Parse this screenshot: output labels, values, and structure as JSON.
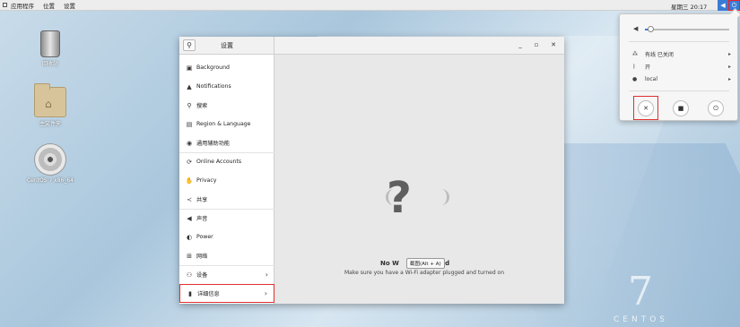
{
  "topbar": {
    "apps": "应用程序",
    "places": "位置",
    "settings": "设置",
    "clock": "星期三 20:17"
  },
  "desktop": {
    "trash_label": "回收站",
    "home_label": "主文件夹",
    "disc_label": "CentOS 7 x86_64"
  },
  "window": {
    "title": "设置",
    "sidebar": [
      {
        "label": "Background",
        "icon": "image-icon"
      },
      {
        "label": "Notifications",
        "icon": "bell-icon"
      },
      {
        "label": "搜索",
        "icon": "search-icon"
      },
      {
        "label": "Region & Language",
        "icon": "camera-icon"
      },
      {
        "label": "通用辅助功能",
        "icon": "accessibility-icon"
      },
      {
        "label": "Online Accounts",
        "icon": "online-accounts-icon"
      },
      {
        "label": "Privacy",
        "icon": "hand-icon"
      },
      {
        "label": "共享",
        "icon": "share-icon"
      },
      {
        "label": "声音",
        "icon": "speaker-icon"
      },
      {
        "label": "Power",
        "icon": "power-icon"
      },
      {
        "label": "网络",
        "icon": "network-icon"
      },
      {
        "label": "设备",
        "icon": "devices-icon"
      },
      {
        "label": "详细信息",
        "icon": "info-icon"
      }
    ],
    "content": {
      "title": "No W",
      "title_rest": "Found",
      "subtitle": "Make sure you have a Wi-Fi adapter plugged and turned on",
      "tooltip": "截图(Alt + A)"
    }
  },
  "sysmenu": {
    "volume_level": 0.06,
    "wired": "有线 已关闭",
    "bluetooth": "开",
    "user": "local"
  },
  "logo": {
    "number": "7",
    "word": "CENTOS"
  }
}
